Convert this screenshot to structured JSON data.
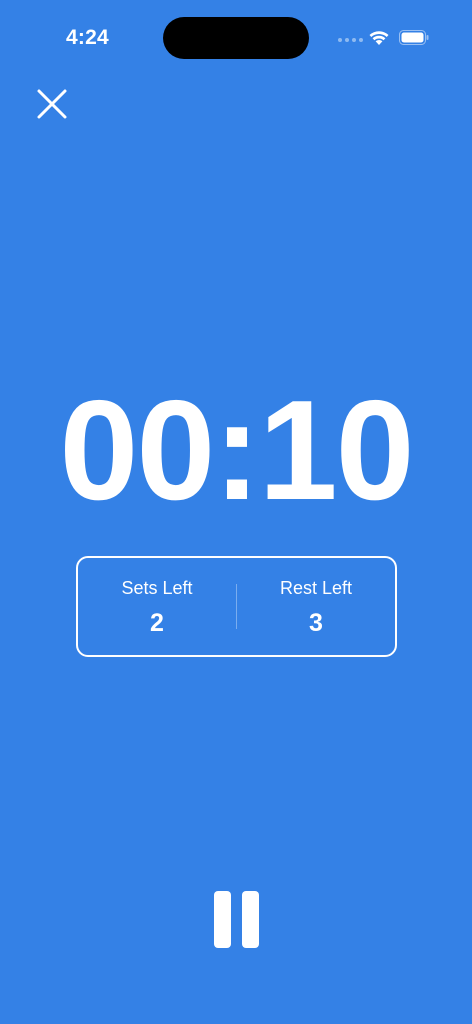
{
  "status_bar": {
    "time": "4:24",
    "icons": [
      "cellular-signal-icon",
      "wifi-icon",
      "battery-icon"
    ]
  },
  "close_icon": "close-icon",
  "timer": {
    "display": "00:10"
  },
  "stats": {
    "sets_left_label": "Sets Left",
    "sets_left_value": "2",
    "rest_left_label": "Rest Left",
    "rest_left_value": "3"
  },
  "pause_icon": "pause-icon",
  "colors": {
    "background": "#3481E6",
    "foreground": "#FFFFFF"
  }
}
